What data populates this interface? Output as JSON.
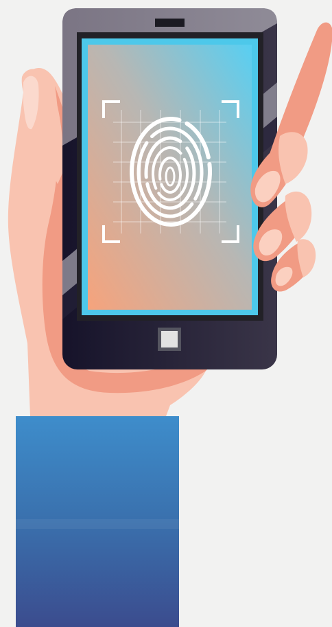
{
  "scene": {
    "subject": "hand-holding-phone",
    "icons": [
      "fingerprint-icon",
      "scan-frame-icon",
      "home-button-icon",
      "speaker-icon"
    ],
    "colors": {
      "background": "#f2f2f1",
      "skin": "#f9c3b0",
      "skin_shadow": "#f19b84",
      "skin_highlight": "#fbd9cd",
      "sleeve_top": "#3e8dcb",
      "sleeve_bottom": "#3b4c8e",
      "phone_body": "#26233a",
      "phone_top": "#8a8693",
      "screen_bezel": "#1f1f23",
      "screen_edge": "#4dc8ea",
      "screen_top": "#5bcef0",
      "screen_bottom": "#f6a57e",
      "fingerprint": "#ffffff",
      "home_button": "#e2e2e2"
    }
  }
}
